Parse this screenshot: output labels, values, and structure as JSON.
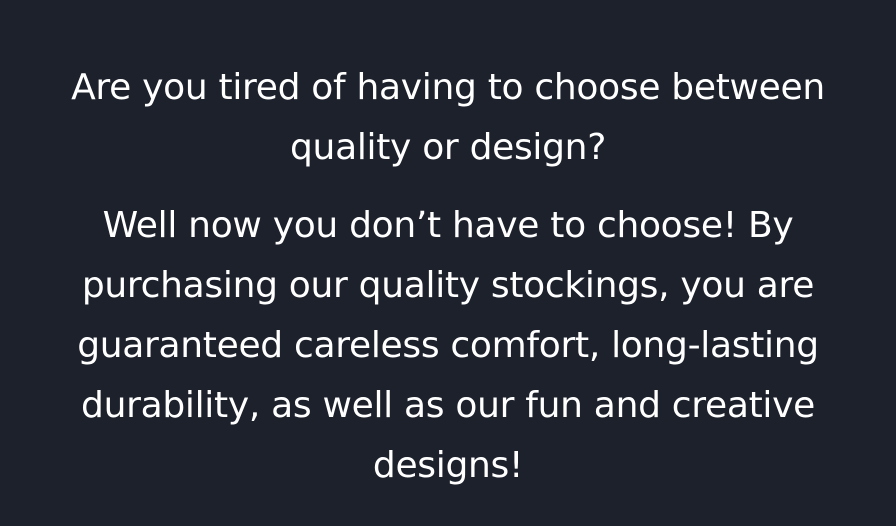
{
  "content": {
    "question": "Are you tired of having to choose between quality or design?",
    "answer": "Well now you don’t have to choose! By purchasing our quality stockings, you are guaranteed careless comfort, long-lasting durability, as well as our fun and creative designs!"
  },
  "colors": {
    "background": "#1c212c",
    "text": "#ffffff"
  }
}
